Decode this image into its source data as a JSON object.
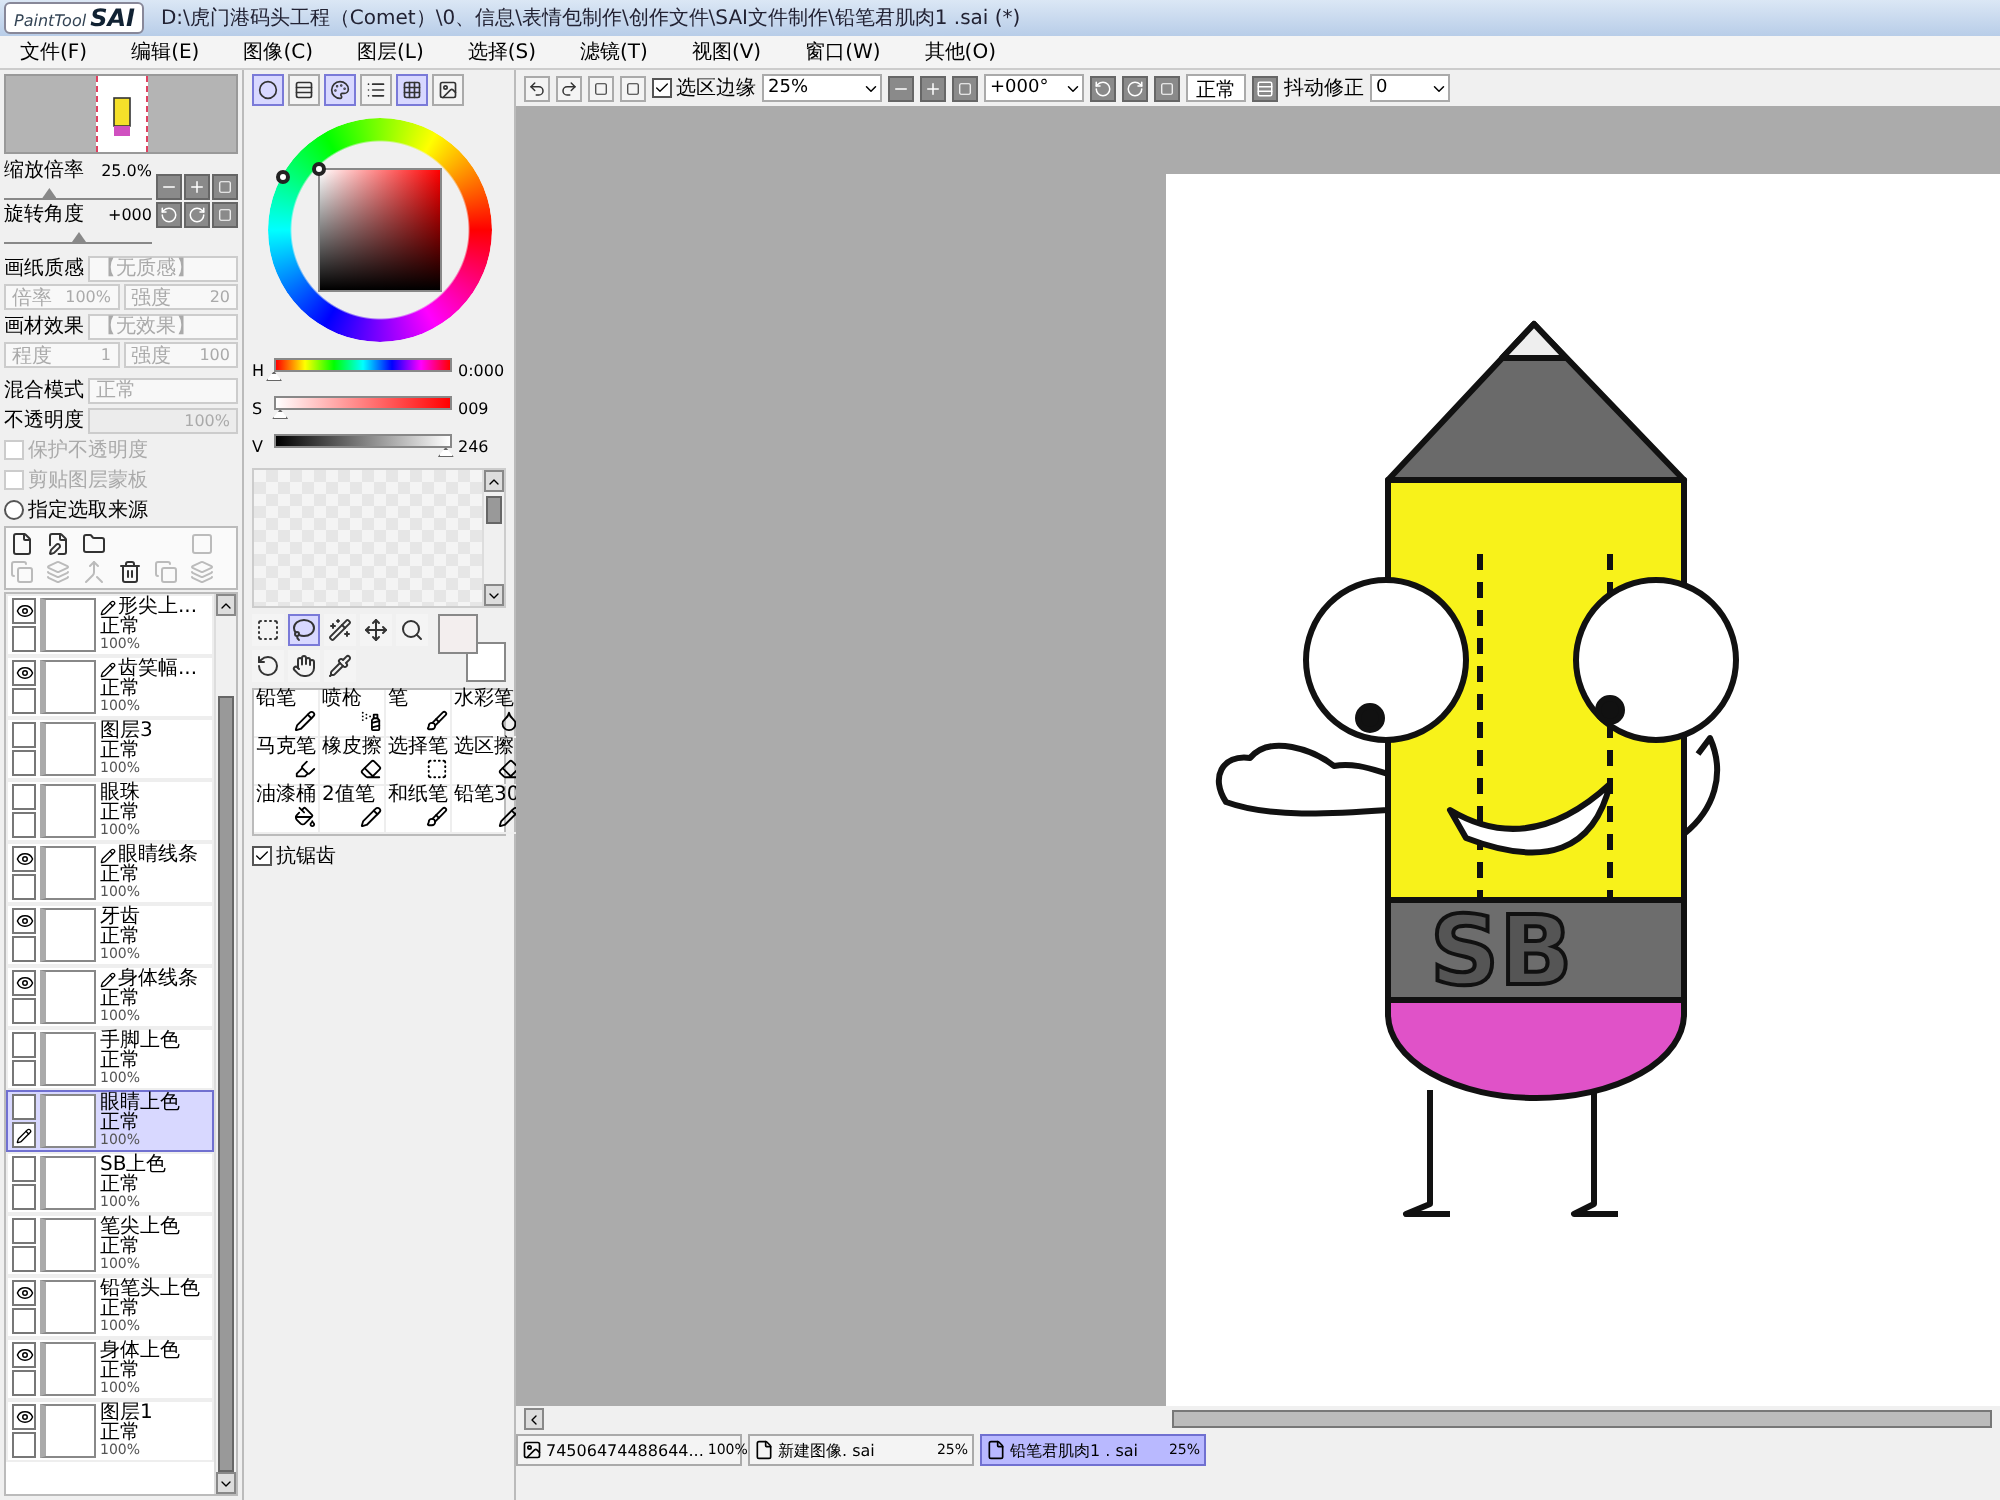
{
  "window": {
    "logo_small": "PaintTool",
    "logo": "SAI",
    "title": "D:\\虎门港码头工程（Comet）\\0、信息\\表情包制作\\创作文件\\SAI文件制作\\铅笔君肌肉1 .sai (*)"
  },
  "menu": [
    "文件(F)",
    "编辑(E)",
    "图像(C)",
    "图层(L)",
    "选择(S)",
    "滤镜(T)",
    "视图(V)",
    "窗口(W)",
    "其他(O)"
  ],
  "navigator": {
    "zoom": {
      "label": "缩放倍率",
      "value": "25.0%",
      "level": 0.3
    },
    "rotate": {
      "label": "旋转角度",
      "value": "+000",
      "level": 0.5
    }
  },
  "paper": {
    "texture_label": "画纸质感",
    "texture_value": "【无质感】",
    "scale_label": "倍率",
    "scale_value": "100%",
    "strength_label": "强度",
    "strength_value": "20",
    "effect_label": "画材效果",
    "effect_value": "【无效果】",
    "degree_label": "程度",
    "degree_value": "1",
    "strength2_label": "强度",
    "strength2_value": "100"
  },
  "blend": {
    "mode_label": "混合模式",
    "mode_value": "正常",
    "opacity_label": "不透明度",
    "opacity_value": "100%",
    "level": 1.0
  },
  "layer_options": [
    {
      "kind": "checkbox",
      "label": "保护不透明度",
      "checked": false,
      "disabled": true
    },
    {
      "kind": "checkbox",
      "label": "剪贴图层蒙板",
      "checked": false,
      "disabled": true
    },
    {
      "kind": "radio",
      "label": "指定选取来源",
      "checked": false,
      "disabled": false
    }
  ],
  "layers": [
    {
      "name": "形尖上...",
      "mode": "正常",
      "opacity": "100%",
      "visible": true,
      "linework": true,
      "selected": false
    },
    {
      "name": "齿笑幅...",
      "mode": "正常",
      "opacity": "100%",
      "visible": true,
      "linework": true,
      "selected": false
    },
    {
      "name": "图层3",
      "mode": "正常",
      "opacity": "100%",
      "visible": false,
      "linework": false,
      "selected": false
    },
    {
      "name": "眼珠",
      "mode": "正常",
      "opacity": "100%",
      "visible": false,
      "linework": false,
      "selected": false
    },
    {
      "name": "眼睛线条",
      "mode": "正常",
      "opacity": "100%",
      "visible": true,
      "linework": true,
      "selected": false
    },
    {
      "name": "牙齿",
      "mode": "正常",
      "opacity": "100%",
      "visible": true,
      "linework": false,
      "selected": false
    },
    {
      "name": "身体线条",
      "mode": "正常",
      "opacity": "100%",
      "visible": true,
      "linework": true,
      "selected": false
    },
    {
      "name": "手脚上色",
      "mode": "正常",
      "opacity": "100%",
      "visible": false,
      "linework": false,
      "selected": false
    },
    {
      "name": "眼睛上色",
      "mode": "正常",
      "opacity": "100%",
      "visible": false,
      "linework": false,
      "selected": true
    },
    {
      "name": "SB上色",
      "mode": "正常",
      "opacity": "100%",
      "visible": false,
      "linework": false,
      "selected": false
    },
    {
      "name": "笔尖上色",
      "mode": "正常",
      "opacity": "100%",
      "visible": false,
      "linework": false,
      "selected": false
    },
    {
      "name": "铅笔头上色",
      "mode": "正常",
      "opacity": "100%",
      "visible": true,
      "linework": false,
      "selected": false
    },
    {
      "name": "身体上色",
      "mode": "正常",
      "opacity": "100%",
      "visible": true,
      "linework": false,
      "selected": false
    },
    {
      "name": "图层1",
      "mode": "正常",
      "opacity": "100%",
      "visible": true,
      "linework": false,
      "selected": false
    }
  ],
  "color_modes": [
    {
      "kind": "wheel",
      "selected": true
    },
    {
      "kind": "bars",
      "selected": false
    },
    {
      "kind": "rgb",
      "selected": true
    },
    {
      "kind": "list",
      "selected": false
    },
    {
      "kind": "swatches",
      "selected": true
    },
    {
      "kind": "tray",
      "selected": false
    }
  ],
  "hsv": [
    {
      "label": "H",
      "value": "0:000",
      "level": 0.0,
      "kind": "hue"
    },
    {
      "label": "S",
      "value": "009",
      "level": 0.035,
      "kind": "sat"
    },
    {
      "label": "V",
      "value": "246",
      "level": 0.965,
      "kind": "val"
    }
  ],
  "tools": [
    {
      "kind": "rect-select",
      "selected": false
    },
    {
      "kind": "lasso",
      "selected": true
    },
    {
      "kind": "wand",
      "selected": false
    },
    {
      "kind": "move",
      "selected": false
    },
    {
      "kind": "zoom",
      "selected": false
    },
    {
      "kind": "rotate",
      "selected": false
    },
    {
      "kind": "hand",
      "selected": false
    },
    {
      "kind": "eyedropper",
      "selected": false
    }
  ],
  "brushes": [
    {
      "name": "铅笔",
      "kind": "pencil"
    },
    {
      "name": "喷枪",
      "kind": "airbrush"
    },
    {
      "name": "笔",
      "kind": "brush"
    },
    {
      "name": "水彩笔",
      "kind": "watercolor"
    },
    {
      "name": "马克笔",
      "kind": "marker"
    },
    {
      "name": "橡皮擦",
      "kind": "eraser"
    },
    {
      "name": "选择笔",
      "kind": "select"
    },
    {
      "name": "选区擦",
      "kind": "deselect"
    },
    {
      "name": "油漆桶",
      "kind": "bucket"
    },
    {
      "name": "2值笔",
      "kind": "binary"
    },
    {
      "name": "和纸笔",
      "kind": "brush"
    },
    {
      "name": "铅笔30",
      "kind": "pencil"
    }
  ],
  "antialias": {
    "label": "抗锯齿",
    "checked": true
  },
  "toolbar": {
    "edge_label": "选区边缘",
    "edge_checked": true,
    "zoom": "25%",
    "angle": "+000°",
    "mode": "正常",
    "stabilizer_label": "抖动修正",
    "stabilizer": "0"
  },
  "canvas": {
    "lettering": "SB"
  },
  "documents": [
    {
      "name": "74506474488644...",
      "zoom": "100%",
      "kind": "image",
      "selected": false
    },
    {
      "name": "新建图像. sai",
      "zoom": "25%",
      "kind": "file",
      "selected": false
    },
    {
      "name": "铅笔君肌肉1 . sai",
      "zoom": "25%",
      "kind": "file",
      "selected": true
    }
  ]
}
